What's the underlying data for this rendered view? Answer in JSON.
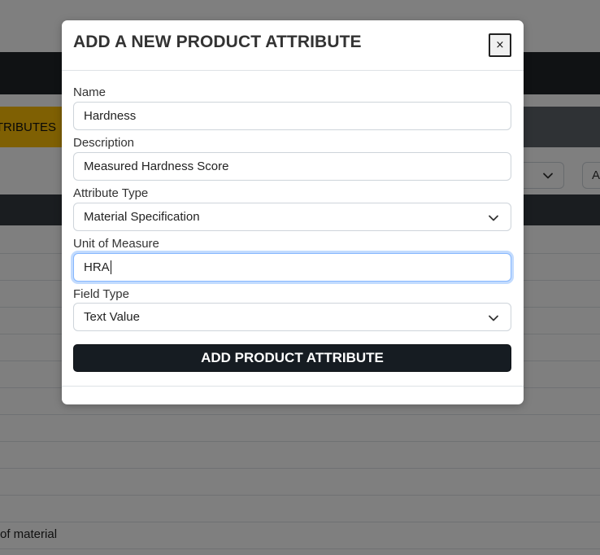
{
  "background": {
    "active_tab_label": "TTRIBUTES",
    "right_button_label": "A",
    "table_cell_text": "of material"
  },
  "modal": {
    "title": "ADD A NEW PRODUCT ATTRIBUTE",
    "close_label": "×",
    "fields": {
      "name": {
        "label": "Name",
        "value": "Hardness"
      },
      "description": {
        "label": "Description",
        "value": "Measured Hardness Score"
      },
      "attribute_type": {
        "label": "Attribute Type",
        "value": "Material Specification"
      },
      "unit_of_measure": {
        "label": "Unit of Measure",
        "value": "HRA"
      },
      "field_type": {
        "label": "Field Type",
        "value": "Text Value"
      }
    },
    "submit_label": "ADD PRODUCT ATTRIBUTE"
  },
  "icons": {
    "select_chevron": "chevron-down-icon",
    "close": "close-icon"
  },
  "colors": {
    "navbar": "#212529",
    "active_tab": "#ffc107",
    "submit_button": "#161c22",
    "focus_ring": "#86b7fe"
  }
}
